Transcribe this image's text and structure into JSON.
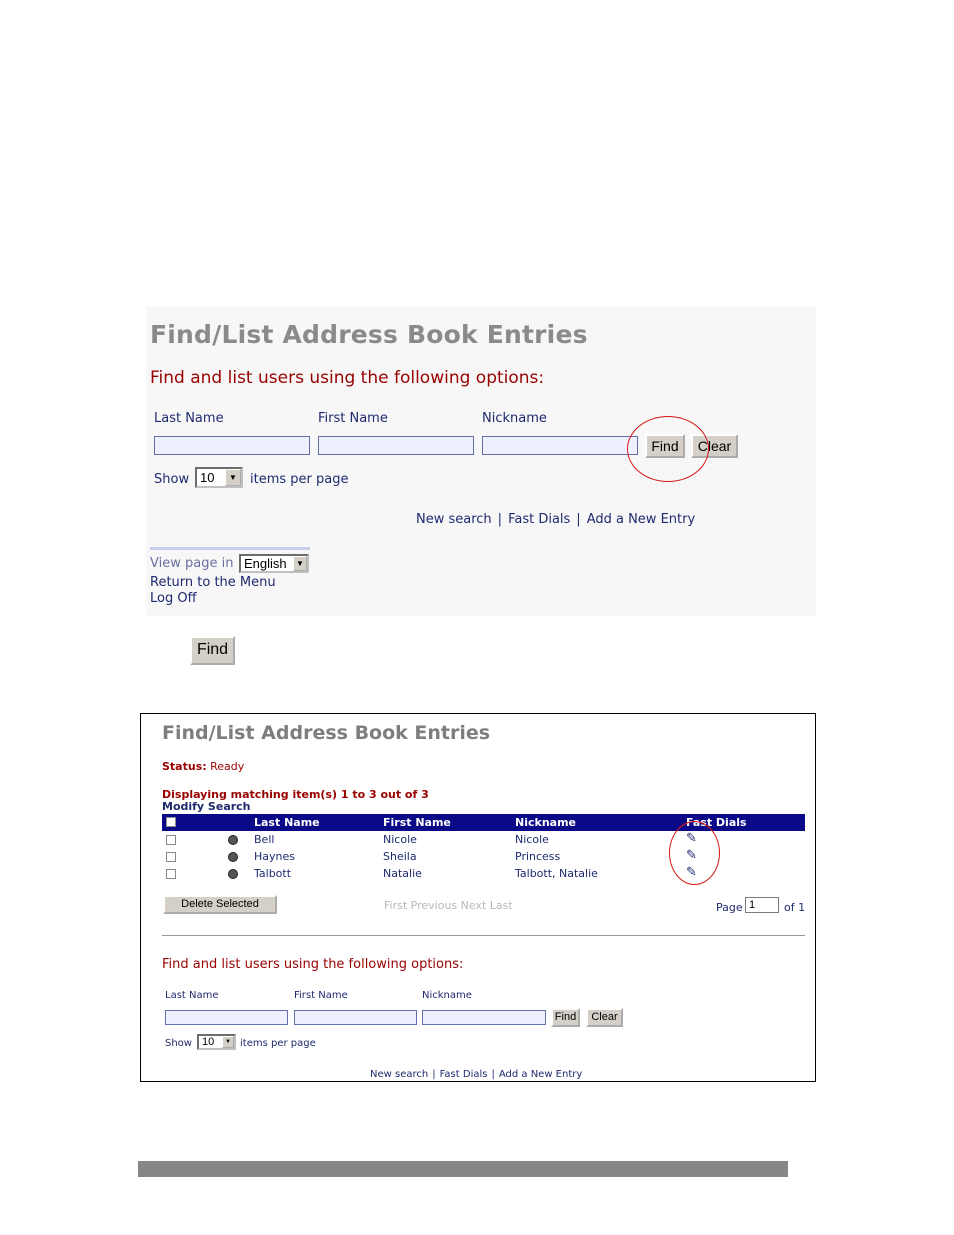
{
  "screen1": {
    "title": "Find/List Address Book Entries",
    "subtitle": "Find and list users using the following options:",
    "fields": [
      {
        "label": "Last Name",
        "value": ""
      },
      {
        "label": "First Name",
        "value": ""
      },
      {
        "label": "Nickname",
        "value": ""
      }
    ],
    "find_label": "Find",
    "clear_label": "Clear",
    "show_label": "Show",
    "items_value": "10",
    "items_suffix": "items per page",
    "links": [
      "New search",
      "Fast Dials",
      "Add a New Entry"
    ],
    "link_separator": "|",
    "view_page_label": "View page in",
    "language": "English",
    "return_menu": "Return to the Menu",
    "log_off": "Log Off",
    "highlight_color": "#d81818"
  },
  "standalone_button": "Find",
  "screen2": {
    "title": "Find/List Address Book Entries",
    "status_label": "Status:",
    "status_value": "Ready",
    "displaying": "Displaying matching item(s) 1 to 3 out of 3",
    "modify": "Modify Search",
    "columns": [
      "Last Name",
      "First Name",
      "Nickname",
      "Fast Dials"
    ],
    "rows": [
      {
        "last": "Bell",
        "first": "Nicole",
        "nickname": "Nicole",
        "fast_dial_icon": "edit-icon"
      },
      {
        "last": "Haynes",
        "first": "Sheila",
        "nickname": "Princess",
        "fast_dial_icon": "edit-icon"
      },
      {
        "last": "Talbott",
        "first": "Natalie",
        "nickname": "Talbott, Natalie",
        "fast_dial_icon": "edit-icon"
      }
    ],
    "delete_label": "Delete Selected",
    "pager": "First Previous Next Last",
    "page_label": "Page",
    "page_value": "1",
    "page_of": "of 1",
    "subtitle": "Find and list users using the following options:",
    "fields": [
      {
        "label": "Last Name",
        "value": ""
      },
      {
        "label": "First Name",
        "value": ""
      },
      {
        "label": "Nickname",
        "value": ""
      }
    ],
    "find_label": "Find",
    "clear_label": "Clear",
    "show_label": "Show",
    "items_value": "10",
    "items_suffix": "items per page",
    "links": [
      "New search",
      "Fast Dials",
      "Add a New Entry"
    ],
    "link_separator": "|",
    "header_color": "#0a0a88"
  }
}
